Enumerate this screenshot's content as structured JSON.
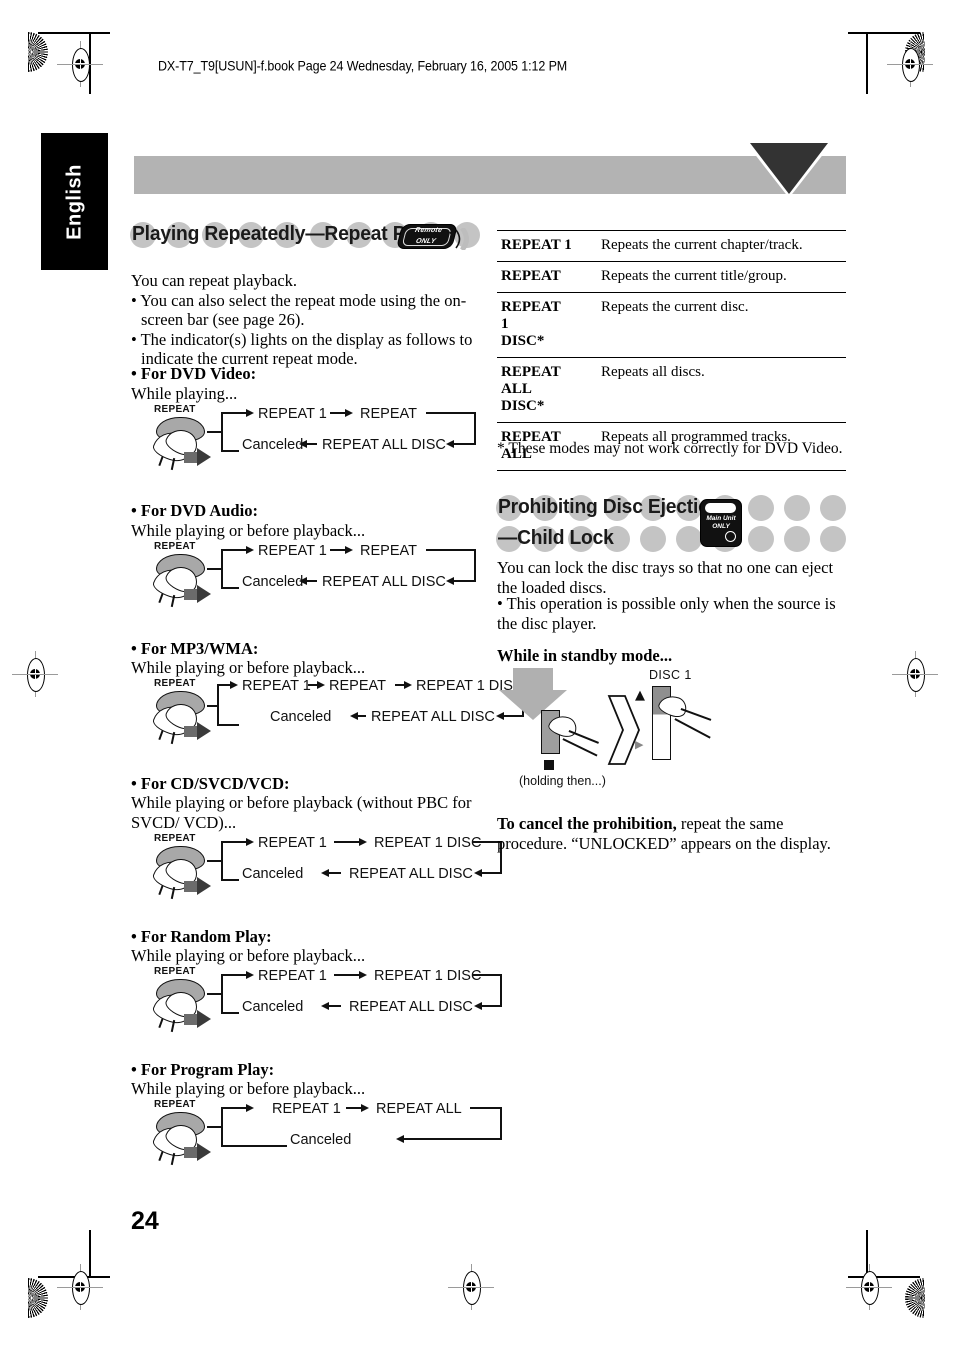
{
  "page": {
    "file_header": "DX-T7_T9[USUN]-f.book  Page 24  Wednesday, February 16, 2005  1:12 PM",
    "language_tab": "English",
    "page_number": "24"
  },
  "left_column": {
    "heading": "Playing Repeatedly—Repeat Play",
    "badge": {
      "line1": "Remote",
      "line2": "ONLY",
      "waves": "⦿"
    },
    "intro": "You can repeat playback.",
    "bullets": [
      "• You can also select the repeat mode using the on-screen bar (see page 26).",
      "• The indicator(s) lights on the display as follows to indicate the current repeat mode."
    ],
    "sections": [
      {
        "title": "• For DVD Video:",
        "condition": "While playing...",
        "button_label": "REPEAT",
        "top_row": [
          "REPEAT 1",
          "REPEAT"
        ],
        "bottom_row": [
          "Canceled",
          "REPEAT ALL DISC"
        ]
      },
      {
        "title": "• For DVD Audio:",
        "condition": "While playing or before playback...",
        "button_label": "REPEAT",
        "top_row": [
          "REPEAT 1",
          "REPEAT"
        ],
        "bottom_row": [
          "Canceled",
          "REPEAT ALL DISC"
        ]
      },
      {
        "title": "• For MP3/WMA:",
        "condition": "While playing or before playback...",
        "button_label": "REPEAT",
        "top_row": [
          "REPEAT 1",
          "REPEAT",
          "REPEAT 1 DISC"
        ],
        "bottom_row": [
          "Canceled",
          "REPEAT ALL DISC"
        ]
      },
      {
        "title": "• For CD/SVCD/VCD:",
        "condition": "While playing or before playback (without PBC for SVCD/ VCD)...",
        "button_label": "REPEAT",
        "top_row": [
          "REPEAT 1",
          "REPEAT 1 DISC"
        ],
        "bottom_row": [
          "Canceled",
          "REPEAT ALL DISC"
        ]
      },
      {
        "title": "• For Random Play:",
        "condition": "While playing or before playback...",
        "button_label": "REPEAT",
        "top_row": [
          "REPEAT 1",
          "REPEAT 1 DISC"
        ],
        "bottom_row": [
          "Canceled",
          "REPEAT ALL DISC"
        ]
      },
      {
        "title": "• For Program Play:",
        "condition": "While playing or before playback...",
        "button_label": "REPEAT",
        "top_row": [
          "REPEAT 1",
          "REPEAT ALL"
        ],
        "bottom_row": [
          "Canceled"
        ]
      }
    ]
  },
  "right_column": {
    "table": {
      "rows": [
        {
          "mode": "REPEAT 1",
          "desc": "Repeats the current chapter/track."
        },
        {
          "mode": "REPEAT",
          "desc": "Repeats the current title/group."
        },
        {
          "mode": "REPEAT 1 DISC*",
          "desc": "Repeats the current disc."
        },
        {
          "mode": "REPEAT ALL DISC*",
          "desc": "Repeats all discs."
        },
        {
          "mode": "REPEAT ALL",
          "desc": "Repeats all programmed tracks."
        }
      ],
      "footnote": "* These modes may not work correctly for DVD Video."
    },
    "heading_line1": "Prohibiting Disc Ejection",
    "heading_line2": "—Child Lock",
    "badge": {
      "line1": "Main Unit",
      "line2": "ONLY"
    },
    "intro": "You can lock the disc trays so that no one can eject the loaded discs.",
    "bullet": "• This operation is possible only when the source is the disc player.",
    "standby_label": "While in standby mode...",
    "figure": {
      "hold_caption": "(holding then...)",
      "disc_label": "DISC 1",
      "eject_glyph": "▲",
      "play_glyph": "▶"
    },
    "cancel_bold": "To cancel the prohibition,",
    "cancel_rest": " repeat the same procedure. “UNLOCKED” appears on the display."
  },
  "colors": {
    "banner_gray": "#b3b3b3",
    "dot_gray": "#c4c4c4",
    "triangle_dark": "#333333",
    "tab_black": "#000000"
  }
}
